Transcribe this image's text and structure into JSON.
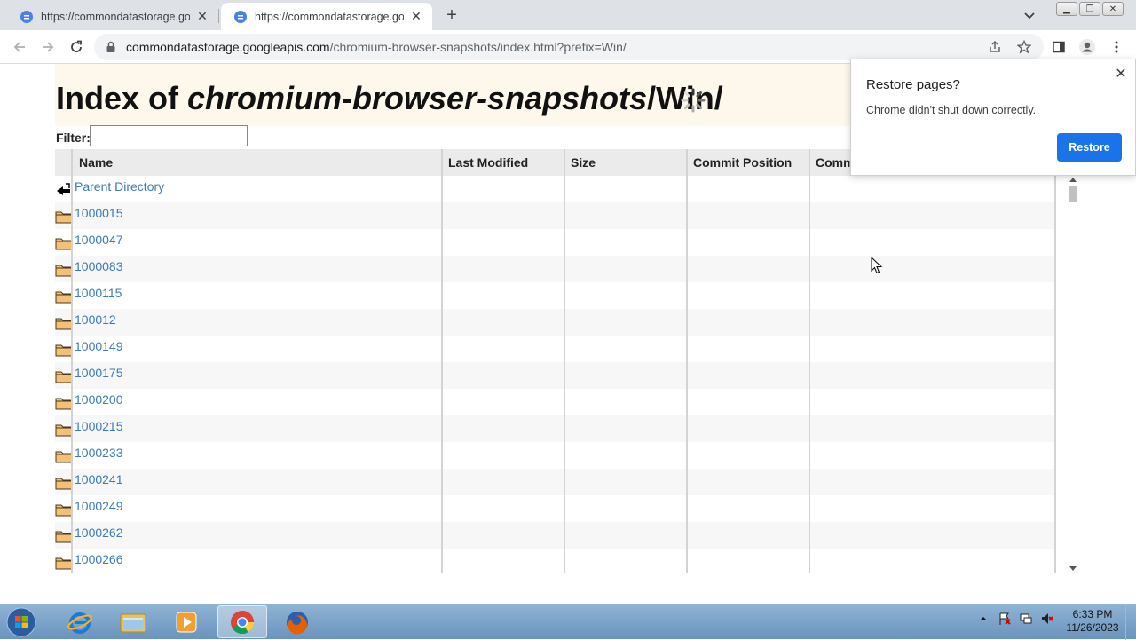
{
  "tabs": [
    {
      "title": "https://commondatastorage.goo",
      "active": false
    },
    {
      "title": "https://commondatastorage.goo",
      "active": true
    }
  ],
  "omnibox": {
    "host": "commondatastorage.googleapis.com",
    "path": "/chromium-browser-snapshots/index.html?prefix=Win/"
  },
  "page": {
    "title_prefix": "Index of ",
    "title_bucket": "chromium-browser-snapshots",
    "title_suffix": "/Win/",
    "filter_label": "Filter:",
    "filter_value": "",
    "columns": [
      "Name",
      "Last Modified",
      "Size",
      "Commit Position",
      "Comm"
    ],
    "rows": [
      {
        "name": "Parent Directory",
        "icon": "back-arrow-icon"
      },
      {
        "name": "1000015",
        "icon": "folder-icon"
      },
      {
        "name": "1000047",
        "icon": "folder-icon"
      },
      {
        "name": "1000083",
        "icon": "folder-icon"
      },
      {
        "name": "1000115",
        "icon": "folder-icon"
      },
      {
        "name": "100012",
        "icon": "folder-icon"
      },
      {
        "name": "1000149",
        "icon": "folder-icon"
      },
      {
        "name": "1000175",
        "icon": "folder-icon"
      },
      {
        "name": "1000200",
        "icon": "folder-icon"
      },
      {
        "name": "1000215",
        "icon": "folder-icon"
      },
      {
        "name": "1000233",
        "icon": "folder-icon"
      },
      {
        "name": "1000241",
        "icon": "folder-icon"
      },
      {
        "name": "1000249",
        "icon": "folder-icon"
      },
      {
        "name": "1000262",
        "icon": "folder-icon"
      },
      {
        "name": "1000266",
        "icon": "folder-icon"
      }
    ]
  },
  "popup": {
    "title": "Restore pages?",
    "message": "Chrome didn't shut down correctly.",
    "button": "Restore"
  },
  "taskbar": {
    "apps": [
      "internet-explorer-icon",
      "file-explorer-icon",
      "media-player-icon",
      "chrome-icon",
      "firefox-icon"
    ],
    "active_app": "chrome-icon",
    "time": "6:33 PM",
    "date": "11/26/2023"
  },
  "colors": {
    "accent": "#1a73e8",
    "link": "#3d7ab5",
    "header_band": "#fef8ec"
  }
}
